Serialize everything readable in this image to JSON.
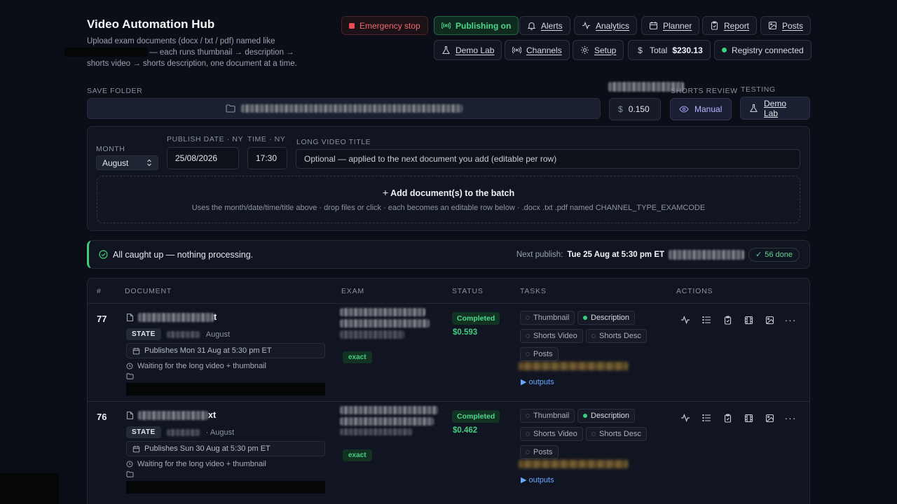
{
  "header": {
    "title": "Video Automation Hub",
    "subtitle_before": "Upload exam documents (docx / txt / pdf) named like",
    "subtitle_after": "— each runs thumbnail → description → shorts video → shorts description, one document at a time."
  },
  "toolbar": {
    "emergency_stop": "Emergency stop",
    "publishing": "Publishing on",
    "alerts": "Alerts",
    "analytics": "Analytics",
    "planner": "Planner",
    "report": "Report",
    "posts": "Posts",
    "demo_lab": "Demo Lab",
    "channels": "Channels",
    "setup": "Setup",
    "total_label": "Total",
    "total_value": "$230.13",
    "registry": "Registry connected"
  },
  "settings": {
    "save_folder_label": "SAVE FOLDER",
    "shorts_review_label": "SHORTS REVIEW",
    "testing_label": "TESTING",
    "threshold_value": "0.150",
    "shorts_review_value": "Manual",
    "testing_button": "Demo Lab"
  },
  "batch": {
    "month_label": "MONTH",
    "month_value": "August",
    "date_label": "PUBLISH DATE · NY",
    "date_value": "25/08/2026",
    "time_label": "TIME · NY",
    "time_value": "17:30",
    "title_label": "LONG VIDEO TITLE",
    "title_placeholder": "Optional — applied to the next document you add (editable per row)",
    "add_heading": "Add document(s) to the batch",
    "add_hint": "Uses the month/date/time/title above · drop files or click · each becomes an editable row below · .docx .txt .pdf named CHANNEL_TYPE_EXAMCODE"
  },
  "status": {
    "message": "All caught up — nothing processing.",
    "next_label": "Next publish:",
    "next_value": "Tue 25 Aug at 5:30 pm ET",
    "done_count": "56 done"
  },
  "table": {
    "columns": [
      "#",
      "DOCUMENT",
      "EXAM",
      "STATUS",
      "TASKS",
      "ACTIONS"
    ],
    "rows": [
      {
        "num": "77",
        "name_suffix": "t",
        "state_pill": "STATE",
        "state_month": "August",
        "publishes": "Publishes Mon 31 Aug at 5:30 pm ET",
        "waiting": "Waiting for the long video + thumbnail",
        "exam_badge": "exact",
        "status": "Completed",
        "cost": "$0.593",
        "tasks": [
          "Thumbnail",
          "Description",
          "Shorts Video",
          "Shorts Desc",
          "Posts"
        ],
        "outputs": "▶ outputs"
      },
      {
        "num": "76",
        "name_suffix": "xt",
        "state_pill": "STATE",
        "state_month": "· August",
        "publishes": "Publishes Sun 30 Aug at 5:30 pm ET",
        "waiting": "Waiting for the long video + thumbnail",
        "exam_badge": "exact",
        "status": "Completed",
        "cost": "$0.462",
        "tasks": [
          "Thumbnail",
          "Description",
          "Shorts Video",
          "Shorts Desc",
          "Posts"
        ],
        "outputs": "▶ outputs"
      }
    ]
  },
  "colors": {
    "accent_green": "#3ecf7d",
    "danger": "#ea4c54",
    "link_blue": "#6aa7ff",
    "background": "#0b0e16"
  }
}
